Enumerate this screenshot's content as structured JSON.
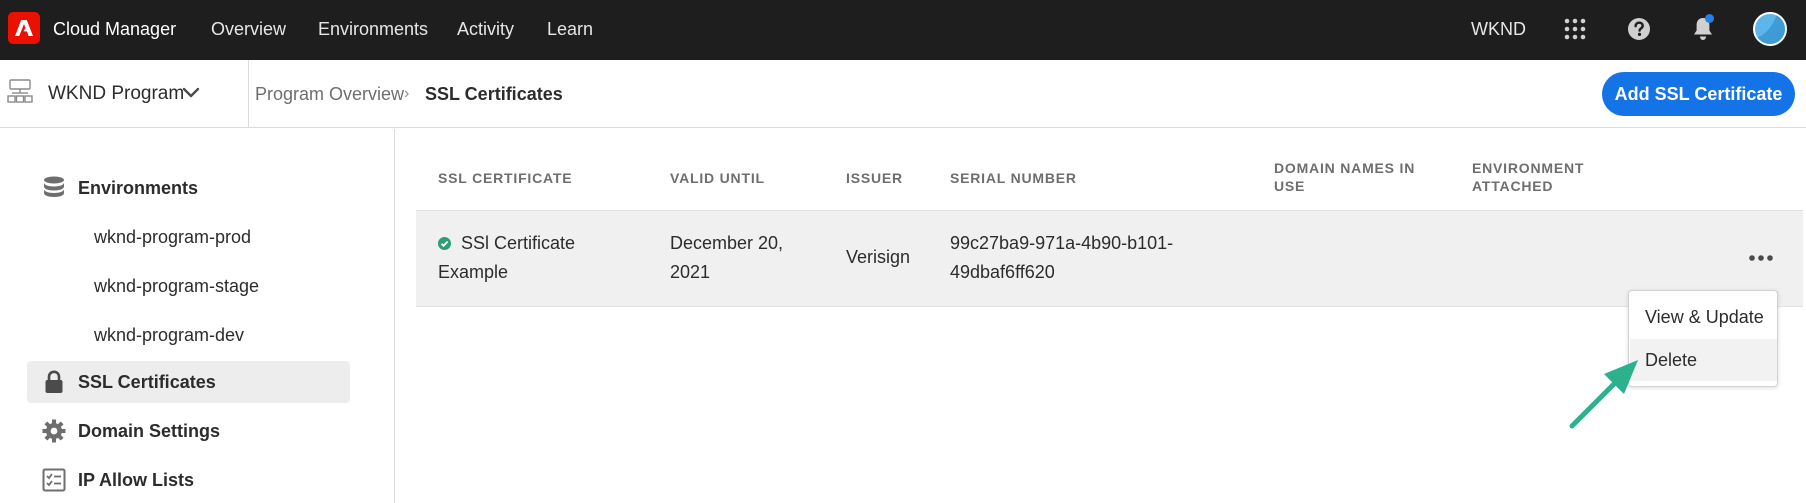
{
  "topbar": {
    "app_title": "Cloud Manager",
    "nav": [
      "Overview",
      "Environments",
      "Activity",
      "Learn"
    ],
    "org_name": "WKND",
    "icons": [
      "app-switcher-icon",
      "help-icon",
      "bell-icon"
    ],
    "notification_dot_color": "#2680eb"
  },
  "subheader": {
    "program_name": "WKND Program",
    "breadcrumb": [
      "Program Overview",
      "SSL Certificates"
    ],
    "breadcrumb_separator": "›",
    "primary_button": "Add SSL Certificate"
  },
  "sidebar": {
    "environments_label": "Environments",
    "environments": [
      "wknd-program-prod",
      "wknd-program-stage",
      "wknd-program-dev"
    ],
    "ssl_label": "SSL Certificates",
    "domain_label": "Domain Settings",
    "ip_label": "IP Allow Lists"
  },
  "table": {
    "headers": {
      "certificate": "SSL CERTIFICATE",
      "valid_until": "VALID UNTIL",
      "issuer": "ISSUER",
      "serial": "SERIAL NUMBER",
      "domains_1": "DOMAIN NAMES IN",
      "domains_2": "USE",
      "env_1": "ENVIRONMENT",
      "env_2": "ATTACHED"
    },
    "row": {
      "name_1": "SSl Certificate",
      "name_2": "Example",
      "valid_1": "December 20,",
      "valid_2": "2021",
      "issuer": "Verisign",
      "serial_1": "99c27ba9-971a-4b90-b101-",
      "serial_2": "49dbaf6ff620",
      "status_color": "#2d9d78"
    }
  },
  "menu": {
    "items": [
      "View & Update",
      "Delete"
    ]
  },
  "colors": {
    "accent": "#1473e6",
    "arrow": "#2cb18f",
    "topbar": "#1e1e1e"
  }
}
